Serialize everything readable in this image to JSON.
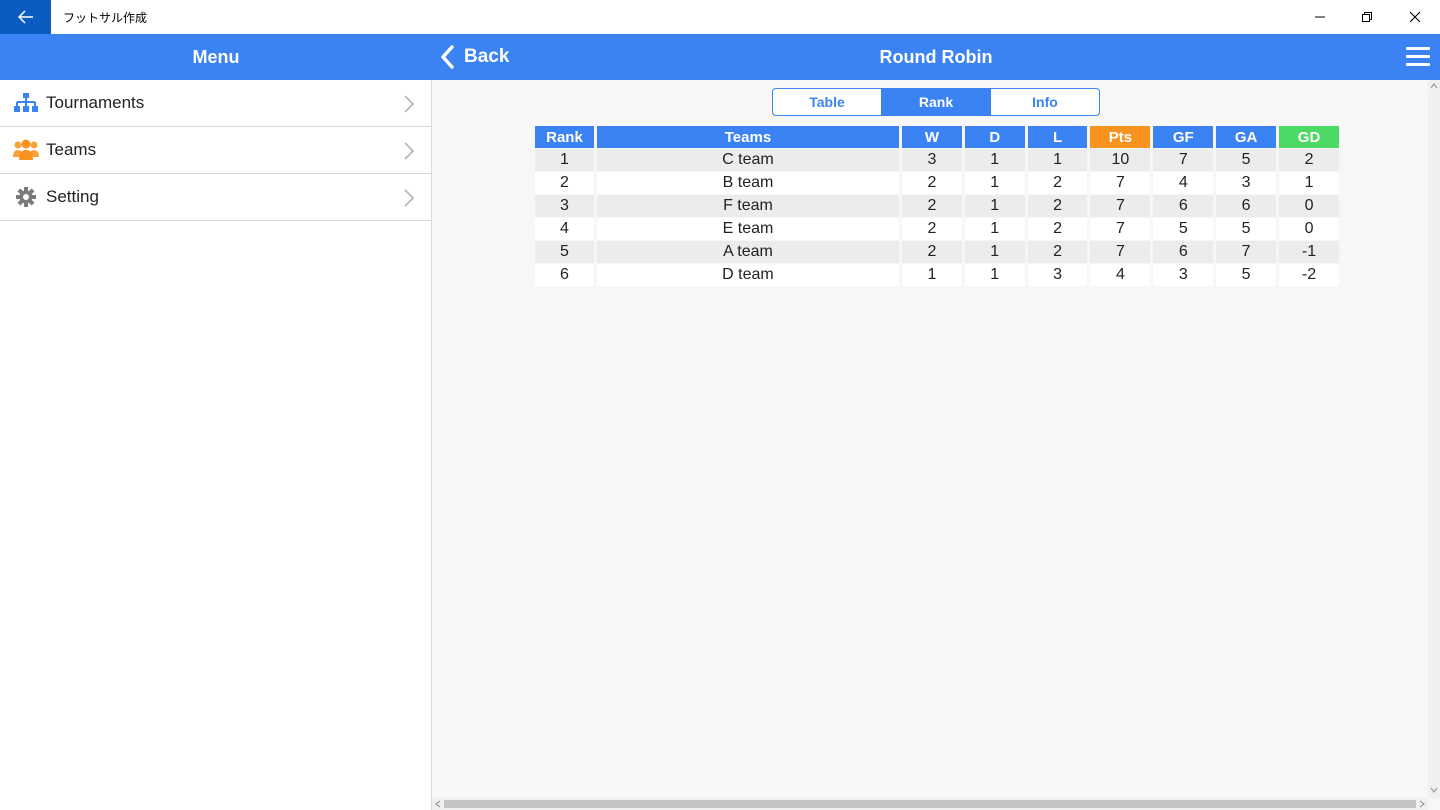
{
  "window": {
    "title": "フットサル作成",
    "back_icon": "arrow-left-icon",
    "accent": "#0a5cc0"
  },
  "header": {
    "menu_title": "Menu",
    "back_label": "Back",
    "page_title": "Round Robin",
    "color": "#3b82f2"
  },
  "sidebar": {
    "items": [
      {
        "label": "Tournaments",
        "icon": "bracket-icon"
      },
      {
        "label": "Teams",
        "icon": "people-icon"
      },
      {
        "label": "Setting",
        "icon": "gear-icon"
      }
    ]
  },
  "tabs": {
    "items": [
      "Table",
      "Rank",
      "Info"
    ],
    "active": "Rank"
  },
  "rank_table": {
    "headers": [
      "Rank",
      "Teams",
      "W",
      "D",
      "L",
      "Pts",
      "GF",
      "GA",
      "GD"
    ],
    "header_colors": {
      "default": "#3b82f2",
      "Pts": "#f8931f",
      "GD": "#4cd964"
    },
    "rows": [
      [
        "1",
        "C team",
        "3",
        "1",
        "1",
        "10",
        "7",
        "5",
        "2"
      ],
      [
        "2",
        "B team",
        "2",
        "1",
        "2",
        "7",
        "4",
        "3",
        "1"
      ],
      [
        "3",
        "F team",
        "2",
        "1",
        "2",
        "7",
        "6",
        "6",
        "0"
      ],
      [
        "4",
        "E team",
        "2",
        "1",
        "2",
        "7",
        "5",
        "5",
        "0"
      ],
      [
        "5",
        "A team",
        "2",
        "1",
        "2",
        "7",
        "6",
        "7",
        "-1"
      ],
      [
        "6",
        "D team",
        "1",
        "1",
        "3",
        "4",
        "3",
        "5",
        "-2"
      ]
    ]
  }
}
